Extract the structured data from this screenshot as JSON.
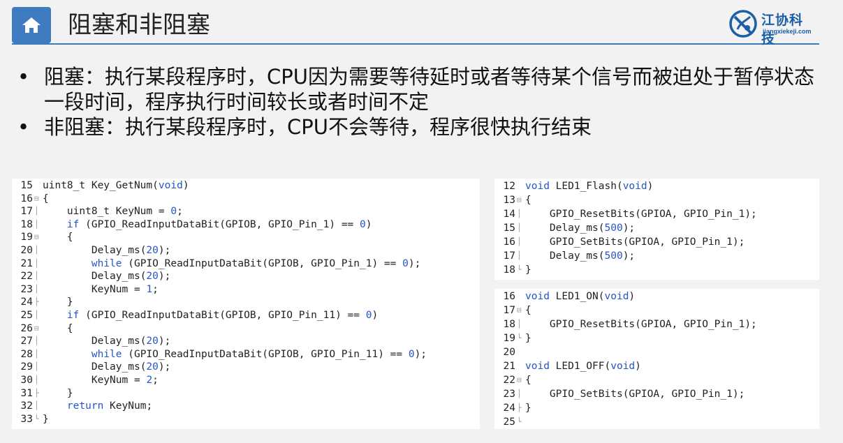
{
  "header": {
    "title": "阻塞和非阻塞",
    "logo_cn": "江协科技",
    "logo_en": "jiangxiekeji.com",
    "accent": "#3e7bc0"
  },
  "bullets": [
    "阻塞：执行某段程序时，CPU因为需要等待延时或者等待某个信号而被迫处于暂停状态一段时间，程序执行时间较长或者时间不定",
    "非阻塞：执行某段程序时，CPU不会等待，程序很快执行结束"
  ],
  "code_left": [
    {
      "n": "15",
      "f": "",
      "t": "uint8_t Key_GetNum(void)"
    },
    {
      "n": "16",
      "f": "⊟",
      "t": "{"
    },
    {
      "n": "17",
      "f": "│",
      "t": "    uint8_t KeyNum = 0;"
    },
    {
      "n": "18",
      "f": "│",
      "t": "    if (GPIO_ReadInputDataBit(GPIOB, GPIO_Pin_1) == 0)"
    },
    {
      "n": "19",
      "f": "⊟",
      "t": "    {"
    },
    {
      "n": "20",
      "f": "│",
      "t": "        Delay_ms(20);"
    },
    {
      "n": "21",
      "f": "│",
      "t": "        while (GPIO_ReadInputDataBit(GPIOB, GPIO_Pin_1) == 0);"
    },
    {
      "n": "22",
      "f": "│",
      "t": "        Delay_ms(20);"
    },
    {
      "n": "23",
      "f": "│",
      "t": "        KeyNum = 1;"
    },
    {
      "n": "24",
      "f": "├",
      "t": "    }"
    },
    {
      "n": "25",
      "f": "│",
      "t": "    if (GPIO_ReadInputDataBit(GPIOB, GPIO_Pin_11) == 0)"
    },
    {
      "n": "26",
      "f": "⊟",
      "t": "    {"
    },
    {
      "n": "27",
      "f": "│",
      "t": "        Delay_ms(20);"
    },
    {
      "n": "28",
      "f": "│",
      "t": "        while (GPIO_ReadInputDataBit(GPIOB, GPIO_Pin_11) == 0);"
    },
    {
      "n": "29",
      "f": "│",
      "t": "        Delay_ms(20);"
    },
    {
      "n": "30",
      "f": "│",
      "t": "        KeyNum = 2;"
    },
    {
      "n": "31",
      "f": "├",
      "t": "    }"
    },
    {
      "n": "32",
      "f": "│",
      "t": "    return KeyNum;"
    },
    {
      "n": "33",
      "f": "└",
      "t": "}"
    }
  ],
  "code_right_top": [
    {
      "n": "12",
      "f": "",
      "t": "void LED1_Flash(void)"
    },
    {
      "n": "13",
      "f": "⊟",
      "t": "{"
    },
    {
      "n": "14",
      "f": "│",
      "t": "    GPIO_ResetBits(GPIOA, GPIO_Pin_1);"
    },
    {
      "n": "15",
      "f": "│",
      "t": "    Delay_ms(500);"
    },
    {
      "n": "16",
      "f": "│",
      "t": "    GPIO_SetBits(GPIOA, GPIO_Pin_1);"
    },
    {
      "n": "17",
      "f": "│",
      "t": "    Delay_ms(500);"
    },
    {
      "n": "18",
      "f": "└",
      "t": "}"
    }
  ],
  "code_right_bottom": [
    {
      "n": "16",
      "f": "",
      "t": "void LED1_ON(void)"
    },
    {
      "n": "17",
      "f": "⊟",
      "t": "{"
    },
    {
      "n": "18",
      "f": "│",
      "t": "    GPIO_ResetBits(GPIOA, GPIO_Pin_1);"
    },
    {
      "n": "19",
      "f": "└",
      "t": "}"
    },
    {
      "n": "20",
      "f": "",
      "t": ""
    },
    {
      "n": "21",
      "f": "",
      "t": "void LED1_OFF(void)"
    },
    {
      "n": "22",
      "f": "⊟",
      "t": "{"
    },
    {
      "n": "23",
      "f": "│",
      "t": "    GPIO_SetBits(GPIOA, GPIO_Pin_1);"
    },
    {
      "n": "24",
      "f": "├",
      "t": "}"
    },
    {
      "n": "25",
      "f": "└",
      "t": ""
    }
  ]
}
